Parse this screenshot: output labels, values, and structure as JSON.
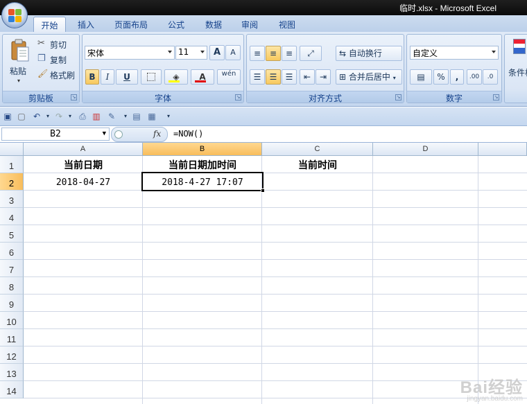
{
  "window": {
    "title": "临时.xlsx - Microsoft Excel"
  },
  "tabs": [
    {
      "label": "开始",
      "active": true
    },
    {
      "label": "插入"
    },
    {
      "label": "页面布局"
    },
    {
      "label": "公式"
    },
    {
      "label": "数据"
    },
    {
      "label": "审阅"
    },
    {
      "label": "视图"
    }
  ],
  "ribbon": {
    "clipboard": {
      "label": "剪贴板",
      "paste": "粘贴",
      "cut": "剪切",
      "copy": "复制",
      "format_painter": "格式刷"
    },
    "font": {
      "label": "字体",
      "font_name": "宋体",
      "font_size": "11",
      "bold": "B",
      "italic": "I",
      "underline": "U",
      "wen": "wén",
      "grow": "A",
      "shrink": "A",
      "font_color_letter": "A"
    },
    "alignment": {
      "label": "对齐方式",
      "wrap_text": "自动换行",
      "merge_center": "合并后居中"
    },
    "number": {
      "label": "数字",
      "format": "自定义",
      "percent": "%",
      "comma": ",",
      "inc_decimal": ".00",
      "dec_decimal": ".0"
    },
    "styles": {
      "conditional": "条件格"
    }
  },
  "formula_bar": {
    "name_box": "B2",
    "fx": "fx",
    "formula": "=NOW()"
  },
  "sheet": {
    "columns": [
      "A",
      "B",
      "C",
      "D"
    ],
    "rows": [
      "1",
      "2",
      "3",
      "4",
      "5",
      "6",
      "7",
      "8",
      "9",
      "10",
      "11",
      "12",
      "13",
      "14"
    ],
    "cells": {
      "A1": "当前日期",
      "B1": "当前日期加时间",
      "C1": "当前时间",
      "A2": "2018-04-27",
      "B2": "2018-4-27 17:07"
    },
    "selected_cell": "B2"
  },
  "watermark": {
    "brand": "Bai经验",
    "url": "jingyan.baidu.com"
  }
}
